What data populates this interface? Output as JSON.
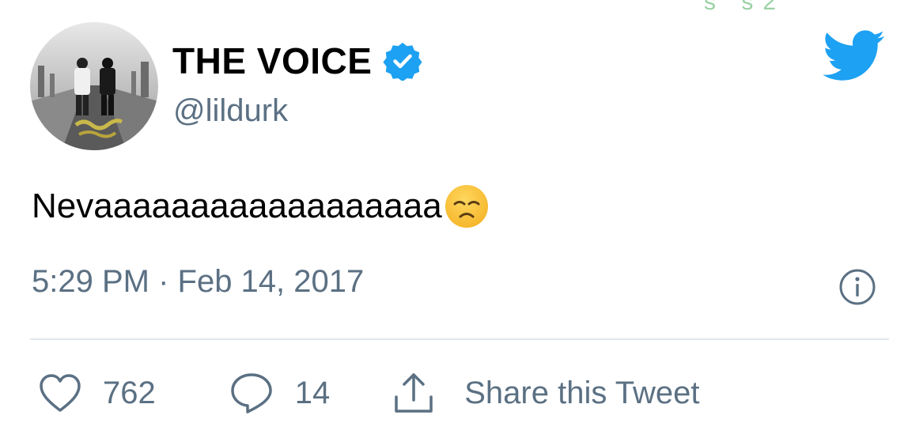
{
  "user": {
    "display_name": "THE VOICE",
    "handle": "@lildurk",
    "verified": true,
    "avatar_icon": "album-cover-avatar"
  },
  "tweet": {
    "text": "Nevaaaaaaaaaaaaaaaaaa",
    "emoji": "disappointed-face",
    "timestamp": "5:29 PM · Feb 14, 2017"
  },
  "actions": {
    "like_count": "762",
    "reply_count": "14",
    "share_label": "Share this Tweet"
  },
  "colors": {
    "brand": "#1da1f2",
    "secondary_text": "#5b7083",
    "divider": "#e1e8ed"
  }
}
